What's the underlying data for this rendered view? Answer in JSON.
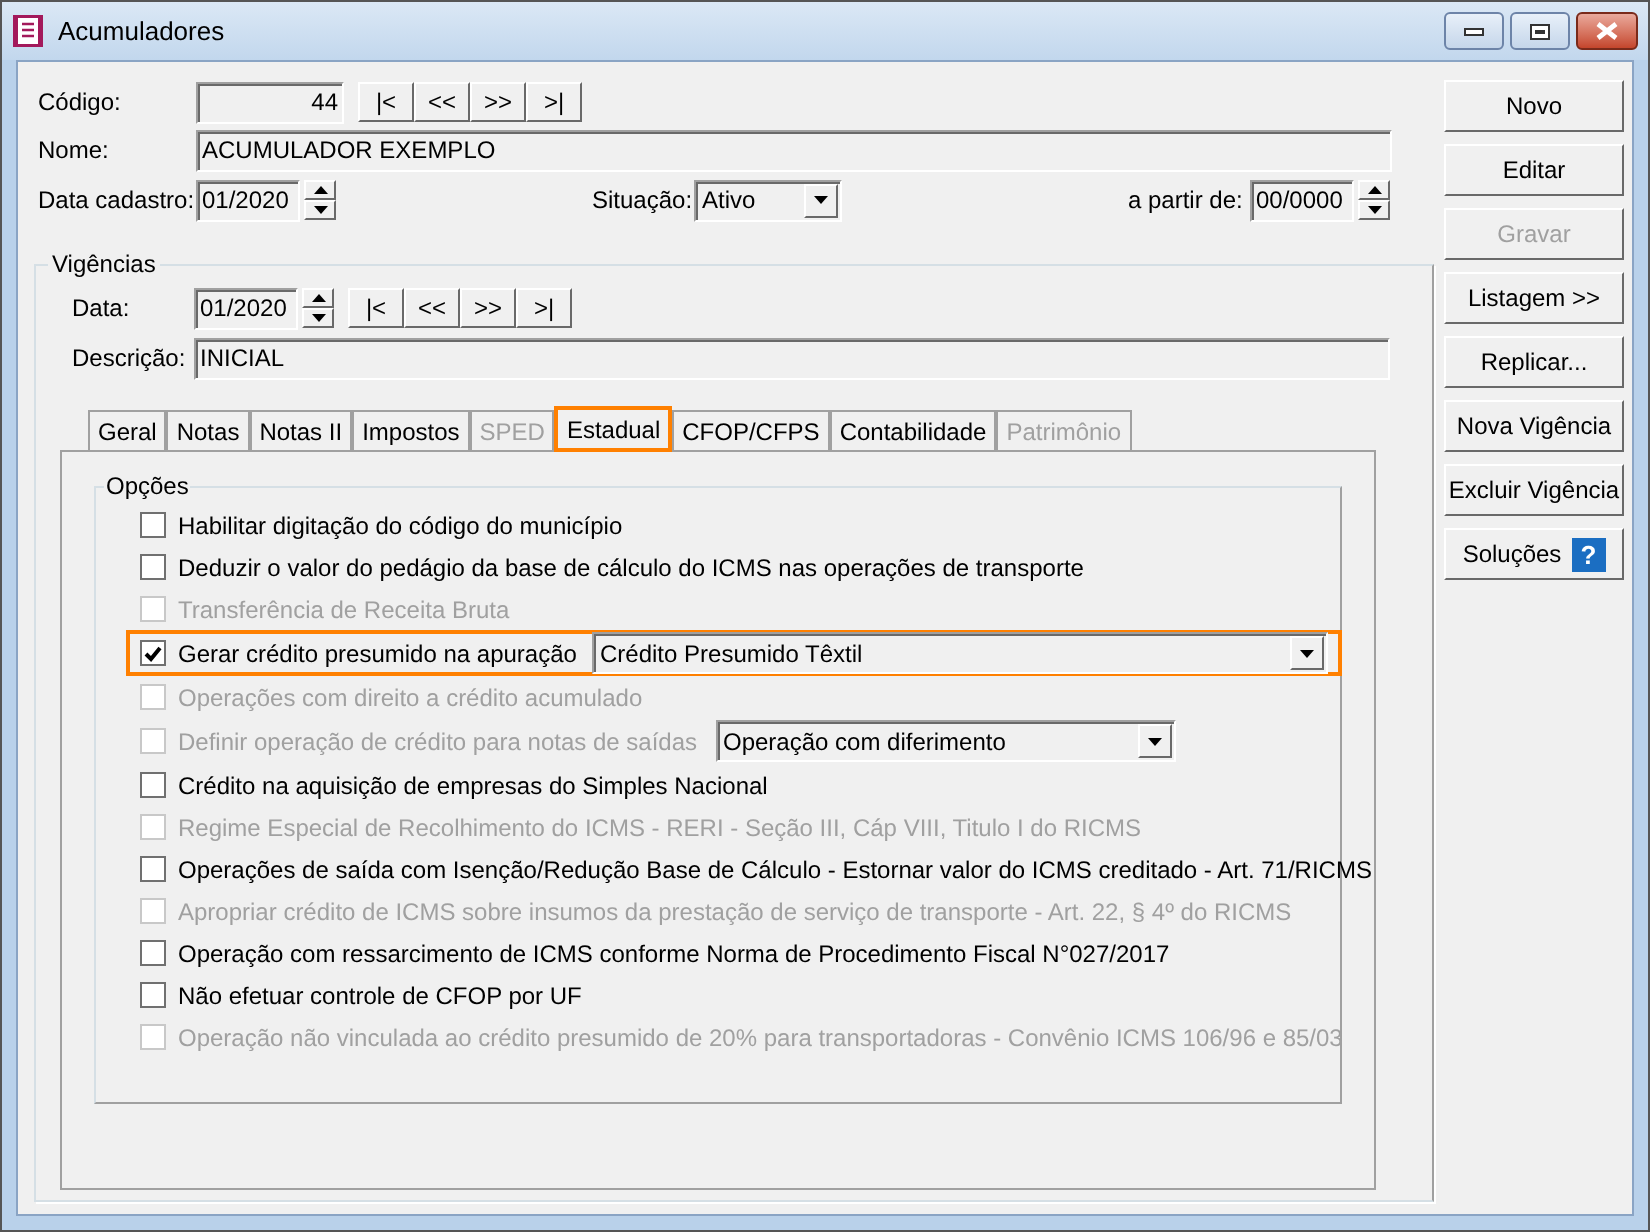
{
  "window": {
    "title": "Acumuladores"
  },
  "header": {
    "codigo_label": "Código:",
    "codigo": "44",
    "nav": [
      "|<",
      "<<",
      ">>",
      ">|"
    ],
    "nome_label": "Nome:",
    "nome": "ACUMULADOR EXEMPLO",
    "data_label": "Data cadastro:",
    "data": "01/2020",
    "situacao_label": "Situação:",
    "situacao": "Ativo",
    "partir_label": "a partir de:",
    "partir": "00/0000"
  },
  "vigencias": {
    "title": "Vigências",
    "data_label": "Data:",
    "data": "01/2020",
    "nav": [
      "|<",
      "<<",
      ">>",
      ">|"
    ],
    "descricao_label": "Descrição:",
    "descricao": "INICIAL"
  },
  "tabs": [
    {
      "label": "Geral",
      "selected": false,
      "disabled": false,
      "highlighted": false
    },
    {
      "label": "Notas",
      "selected": false,
      "disabled": false,
      "highlighted": false
    },
    {
      "label": "Notas II",
      "selected": false,
      "disabled": false,
      "highlighted": false
    },
    {
      "label": "Impostos",
      "selected": false,
      "disabled": false,
      "highlighted": false
    },
    {
      "label": "SPED",
      "selected": false,
      "disabled": true,
      "highlighted": false
    },
    {
      "label": "Estadual",
      "selected": true,
      "disabled": false,
      "highlighted": true
    },
    {
      "label": "CFOP/CFPS",
      "selected": false,
      "disabled": false,
      "highlighted": false
    },
    {
      "label": "Contabilidade",
      "selected": false,
      "disabled": false,
      "highlighted": false
    },
    {
      "label": "Patrimônio",
      "selected": false,
      "disabled": true,
      "highlighted": false
    }
  ],
  "opcoes": {
    "title": "Opções",
    "items": [
      {
        "kind": "checkbox",
        "label": "Habilitar digitação do código do município",
        "checked": false,
        "disabled": false,
        "highlighted": false
      },
      {
        "kind": "checkbox",
        "label": "Deduzir o valor do pedágio da base de cálculo do ICMS nas operações de transporte",
        "checked": false,
        "disabled": false,
        "highlighted": false
      },
      {
        "kind": "checkbox",
        "label": "Transferência de Receita Bruta",
        "checked": false,
        "disabled": true,
        "highlighted": false
      },
      {
        "kind": "checkbox_select",
        "label": "Gerar crédito presumido na apuração",
        "checked": true,
        "disabled": false,
        "highlighted": true,
        "value": "Crédito Presumido Têxtil"
      },
      {
        "kind": "checkbox",
        "label": "Operações com direito a crédito acumulado",
        "checked": false,
        "disabled": true,
        "highlighted": false
      },
      {
        "kind": "checkbox_select",
        "label": "Definir operação de crédito para notas de saídas",
        "checked": false,
        "disabled": true,
        "highlighted": false,
        "value": "Operação com diferimento"
      },
      {
        "kind": "checkbox",
        "label": "Crédito na aquisição de empresas do Simples Nacional",
        "checked": false,
        "disabled": false,
        "highlighted": false
      },
      {
        "kind": "checkbox",
        "label": "Regime Especial de Recolhimento do ICMS - RERI - Seção III, Cáp VIII, Titulo I do RICMS",
        "checked": false,
        "disabled": true,
        "highlighted": false
      },
      {
        "kind": "checkbox",
        "label": "Operações de saída com Isenção/Redução Base de Cálculo - Estornar valor do ICMS creditado - Art. 71/RICMS",
        "checked": false,
        "disabled": false,
        "highlighted": false
      },
      {
        "kind": "checkbox",
        "label": "Apropriar crédito de ICMS sobre insumos da prestação de serviço de transporte - Art. 22, § 4º do RICMS",
        "checked": false,
        "disabled": true,
        "highlighted": false
      },
      {
        "kind": "checkbox",
        "label": "Operação com ressarcimento de ICMS conforme Norma de Procedimento Fiscal N°027/2017",
        "checked": false,
        "disabled": false,
        "highlighted": false
      },
      {
        "kind": "checkbox",
        "label": "Não efetuar controle de CFOP por UF",
        "checked": false,
        "disabled": false,
        "highlighted": false
      },
      {
        "kind": "checkbox",
        "label": "Operação não vinculada ao crédito presumido de 20% para transportadoras - Convênio ICMS 106/96 e 85/03",
        "checked": false,
        "disabled": true,
        "highlighted": false
      }
    ]
  },
  "buttons": [
    {
      "label": "Novo",
      "disabled": false
    },
    {
      "label": "Editar",
      "disabled": false
    },
    {
      "label": "Gravar",
      "disabled": true
    },
    {
      "label": "Listagem >>",
      "disabled": false
    },
    {
      "label": "Replicar...",
      "disabled": false
    },
    {
      "label": "Nova Vigência",
      "disabled": false
    },
    {
      "label": "Excluir Vigência",
      "disabled": false
    },
    {
      "label": "Soluções",
      "disabled": false,
      "help_icon": "?"
    }
  ]
}
